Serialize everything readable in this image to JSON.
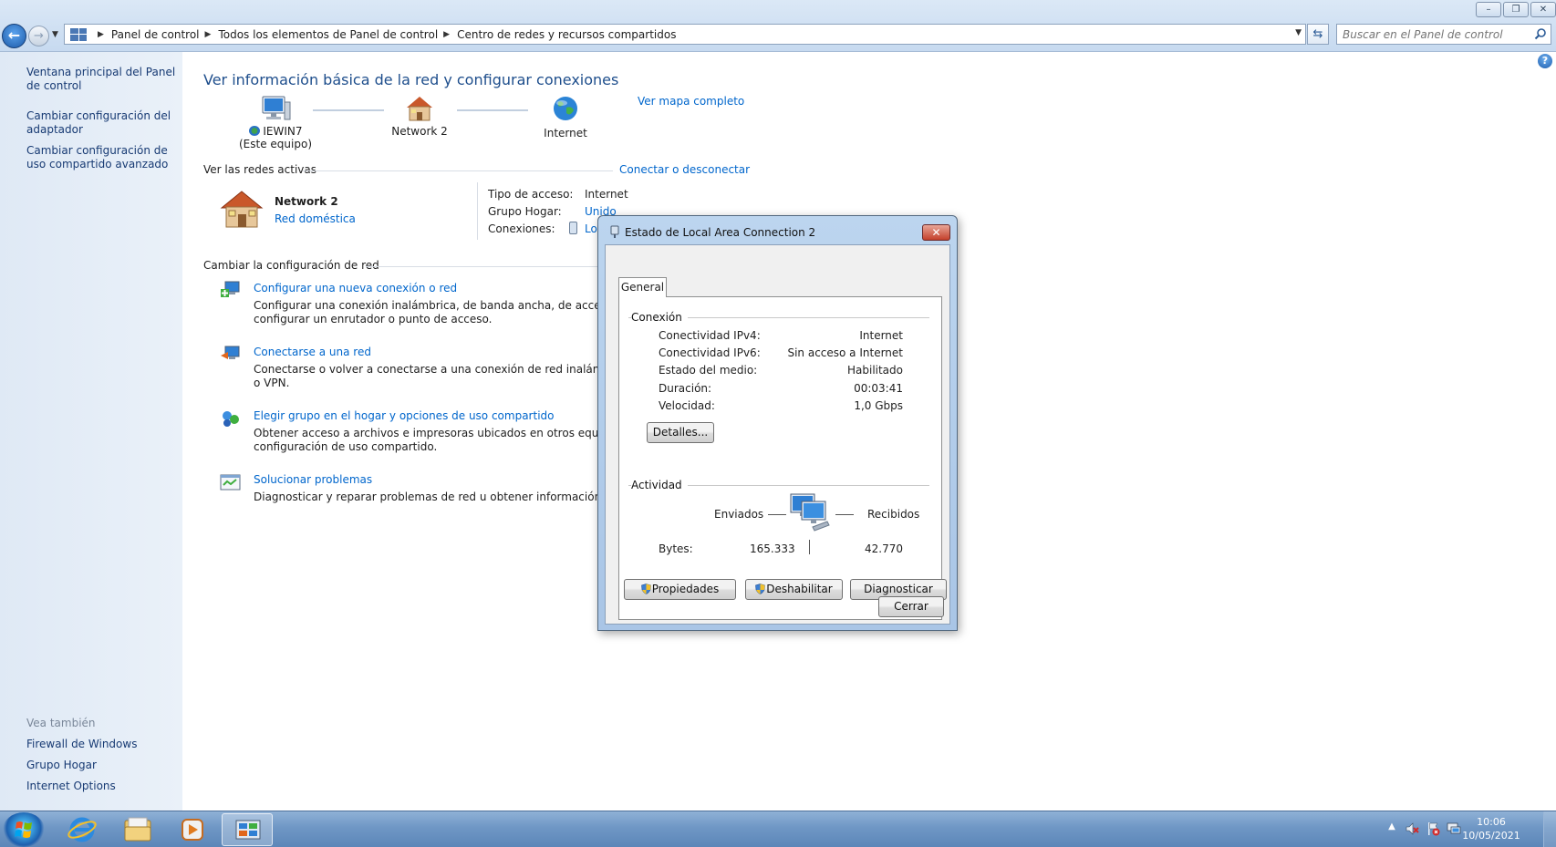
{
  "window": {
    "buttons": [
      "minimize-icon",
      "restore-icon",
      "close-icon"
    ]
  },
  "address": {
    "crumbs": [
      "Panel de control",
      "Todos los elementos de Panel de control",
      "Centro de redes y recursos compartidos"
    ],
    "search_placeholder": "Buscar en el Panel de control"
  },
  "sidebar": {
    "items": [
      {
        "label": "Ventana principal del Panel de control"
      },
      {
        "label": "Cambiar configuración del adaptador"
      },
      {
        "label": "Cambiar configuración de uso compartido avanzado"
      }
    ],
    "see_also_label": "Vea también",
    "see_also": [
      {
        "label": "Firewall de Windows"
      },
      {
        "label": "Grupo Hogar"
      },
      {
        "label": "Internet Options"
      }
    ]
  },
  "main": {
    "title": "Ver información básica de la red y configurar conexiones",
    "map": {
      "computer_name": "IEWIN7",
      "computer_sub": "(Este equipo)",
      "network": "Network  2",
      "internet": "Internet",
      "full_map_link": "Ver mapa completo"
    },
    "active_networks": {
      "heading": "Ver las redes activas",
      "connect_link": "Conectar o desconectar",
      "network_name": "Network  2",
      "network_type": "Red doméstica",
      "access_type_label": "Tipo de acceso:",
      "access_type_value": "Internet",
      "homegroup_label": "Grupo Hogar:",
      "homegroup_value": "Unido",
      "connections_label": "Conexiones:",
      "connections_value": "Lo"
    },
    "change_settings": {
      "heading": "Cambiar la configuración de red",
      "tasks": [
        {
          "title": "Configurar una nueva conexión o red",
          "desc1": "Configurar una conexión inalámbrica, de banda ancha, de acceso telefó",
          "desc2": "configurar un enrutador o punto de acceso."
        },
        {
          "title": "Conectarse a una red",
          "desc1": "Conectarse o volver a conectarse a una conexión de red inalámbrica, cab",
          "desc2": "o VPN."
        },
        {
          "title": "Elegir grupo en el hogar y opciones de uso compartido",
          "desc1": "Obtener acceso a archivos e impresoras ubicados en otros equipos de la",
          "desc2": "configuración de uso compartido."
        },
        {
          "title": "Solucionar problemas",
          "desc1": "Diagnosticar y reparar problemas de red u obtener información de soluc",
          "desc2": ""
        }
      ]
    }
  },
  "dialog": {
    "title": "Estado de Local Area Connection 2",
    "tab": "General",
    "connection_group": "Conexión",
    "rows": [
      {
        "label": "Conectividad IPv4:",
        "value": "Internet"
      },
      {
        "label": "Conectividad IPv6:",
        "value": "Sin acceso a Internet"
      },
      {
        "label": "Estado del medio:",
        "value": "Habilitado"
      },
      {
        "label": "Duración:",
        "value": "00:03:41"
      },
      {
        "label": "Velocidad:",
        "value": "1,0 Gbps"
      }
    ],
    "details_button": "Detalles...",
    "activity_group": "Actividad",
    "sent_label": "Enviados",
    "received_label": "Recibidos",
    "bytes_label": "Bytes:",
    "bytes_sent": "165.333",
    "bytes_received": "42.770",
    "properties_button": "Propiedades",
    "disable_button": "Deshabilitar",
    "diagnose_button": "Diagnosticar",
    "close_button": "Cerrar"
  },
  "taskbar": {
    "apps": [
      "internet-explorer-icon",
      "explorer-icon",
      "media-player-icon",
      "control-panel-icon"
    ],
    "time": "10:06",
    "date": "10/05/2021"
  }
}
